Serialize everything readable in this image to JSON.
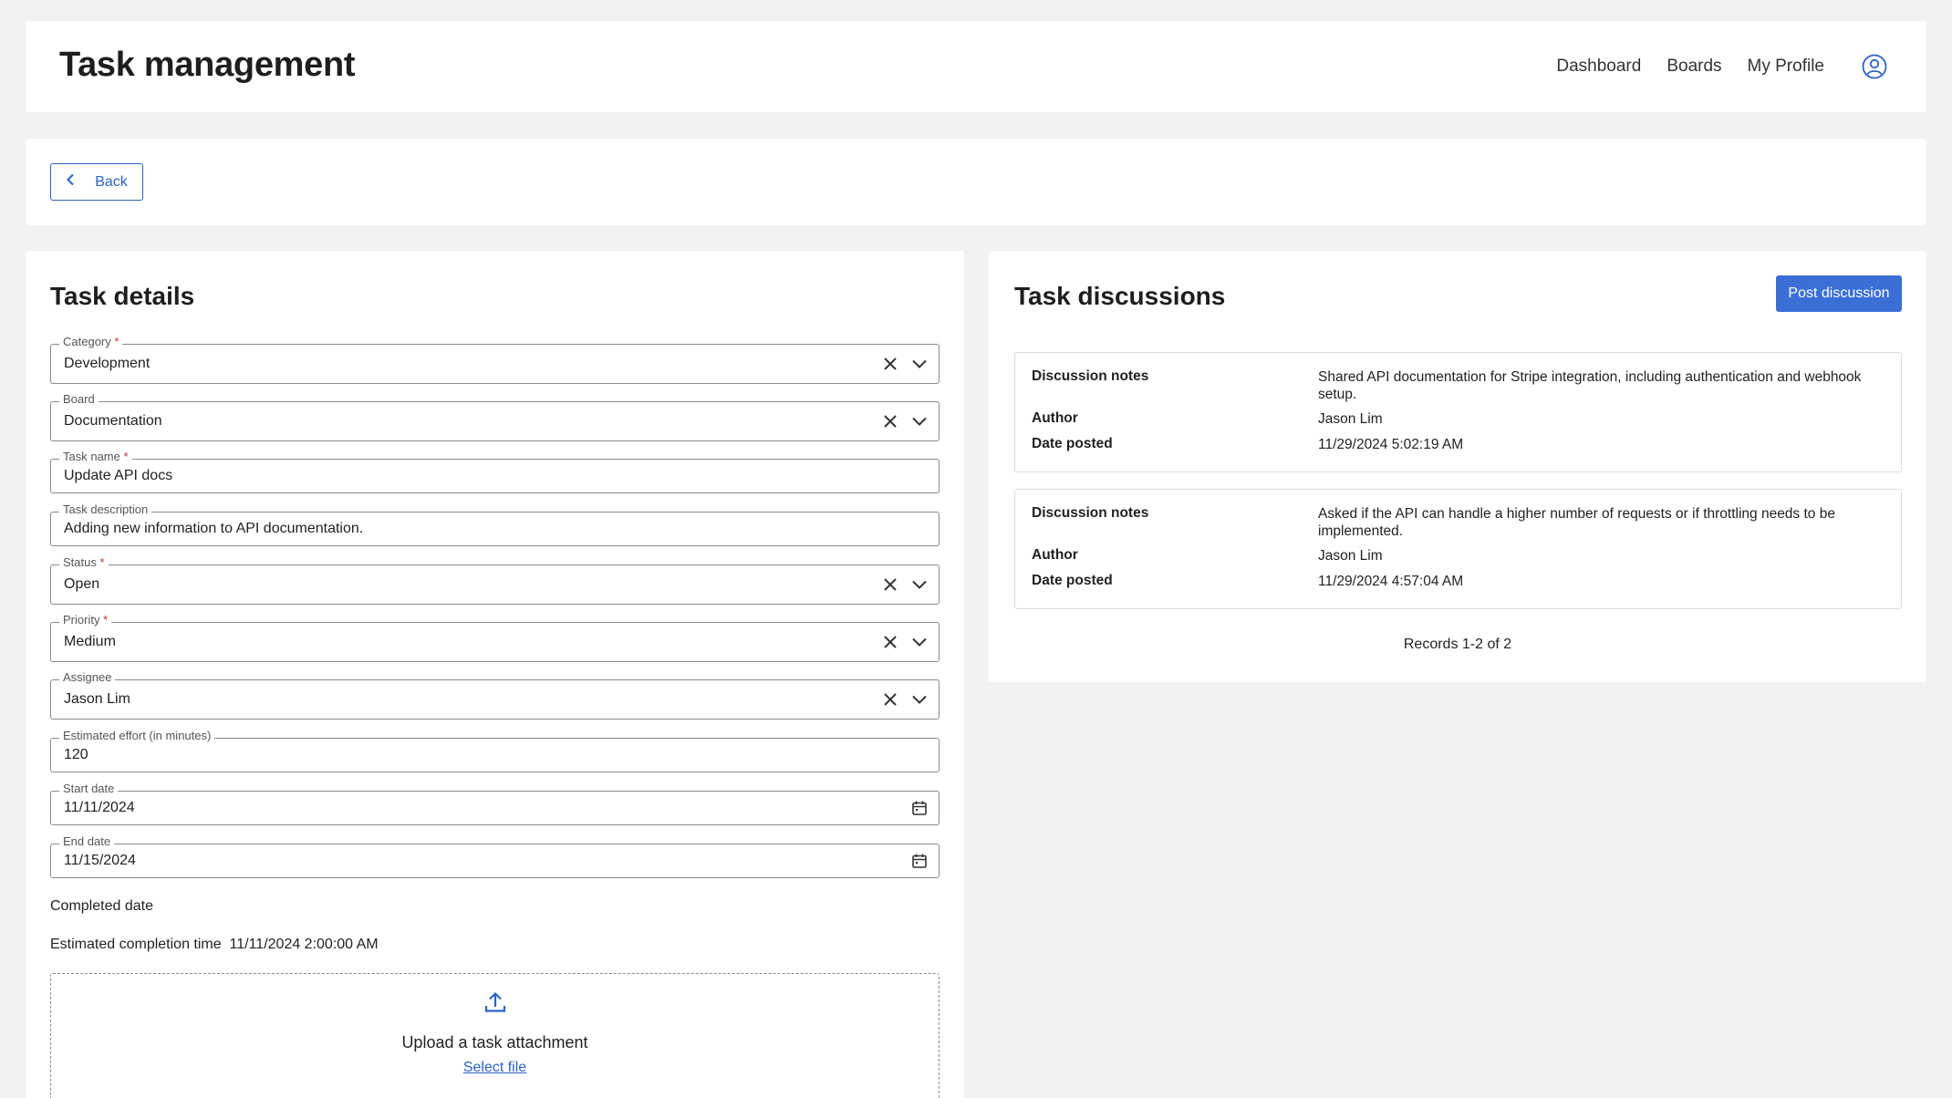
{
  "header": {
    "title": "Task management",
    "nav": [
      "Dashboard",
      "Boards",
      "My Profile"
    ],
    "avatar_icon": "user-circle-icon"
  },
  "back": {
    "label": "Back",
    "icon": "chevron-left-icon"
  },
  "details": {
    "title": "Task details",
    "fields": {
      "category": {
        "label": "Category",
        "required": "*",
        "value": "Development"
      },
      "board": {
        "label": "Board",
        "value": "Documentation"
      },
      "task_name": {
        "label": "Task name",
        "required": "*",
        "value": "Update API docs"
      },
      "task_description": {
        "label": "Task description",
        "value": "Adding new information to API documentation."
      },
      "status": {
        "label": "Status",
        "required": "*",
        "value": "Open"
      },
      "priority": {
        "label": "Priority",
        "required": "*",
        "value": "Medium"
      },
      "assignee": {
        "label": "Assignee",
        "value": "Jason Lim"
      },
      "estimated_effort": {
        "label": "Estimated effort (in minutes)",
        "value": "120"
      },
      "start_date": {
        "label": "Start date",
        "value": "11/11/2024"
      },
      "end_date": {
        "label": "End date",
        "value": "11/15/2024"
      }
    },
    "completed_date_label": "Completed date",
    "estimated_completion_label": "Estimated completion time",
    "estimated_completion_value": "11/11/2024 2:00:00 AM",
    "upload": {
      "text": "Upload a task attachment",
      "link": "Select file",
      "icon": "upload-icon"
    }
  },
  "discussions": {
    "title": "Task discussions",
    "post_label": "Post discussion",
    "keys": {
      "notes": "Discussion notes",
      "author": "Author",
      "date": "Date posted"
    },
    "items": [
      {
        "notes": "Shared API documentation for Stripe integration, including authentication and webhook setup.",
        "author": "Jason Lim",
        "date": "11/29/2024 5:02:19 AM"
      },
      {
        "notes": "Asked if the API can handle a higher number of requests or if throttling needs to be implemented.",
        "author": "Jason Lim",
        "date": "11/29/2024 4:57:04 AM"
      }
    ],
    "records": "Records 1-2 of 2"
  },
  "colors": {
    "accent": "#3b6fd6",
    "link": "#2b62c6",
    "background": "#f2f2f2"
  }
}
